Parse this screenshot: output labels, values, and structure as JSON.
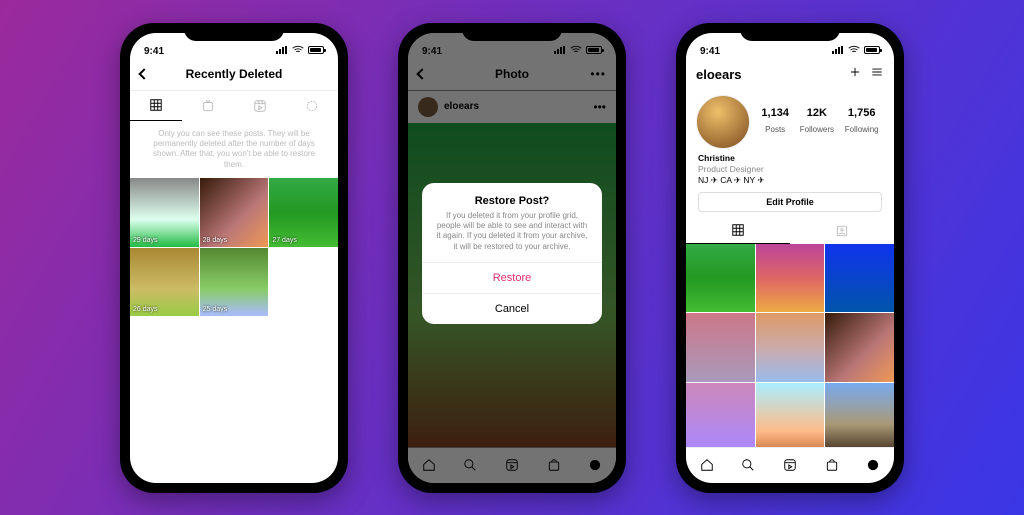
{
  "status_time": "9:41",
  "phone1": {
    "title": "Recently Deleted",
    "info": "Only you can see these posts. They will be permanently deleted after the number of days shown. After that, you won't be able to restore them.",
    "thumbs": [
      {
        "days": "29 days"
      },
      {
        "days": "28 days"
      },
      {
        "days": "27 days"
      },
      {
        "days": "26 days"
      },
      {
        "days": "25 days"
      }
    ]
  },
  "phone2": {
    "title": "Photo",
    "username": "eloears",
    "modal": {
      "title": "Restore Post?",
      "body": "If you deleted it from your profile grid, people will be able to see and interact with it again. If you deleted it from your archive, it will be restored to your archive.",
      "restore": "Restore",
      "cancel": "Cancel"
    }
  },
  "phone3": {
    "username": "eloears",
    "stats": {
      "posts": {
        "n": "1,134",
        "l": "Posts"
      },
      "followers": {
        "n": "12K",
        "l": "Followers"
      },
      "following": {
        "n": "1,756",
        "l": "Following"
      }
    },
    "bio": {
      "name": "Christine",
      "sub": "Product Designer",
      "loc": "NJ ✈ CA ✈ NY ✈"
    },
    "edit": "Edit Profile"
  }
}
